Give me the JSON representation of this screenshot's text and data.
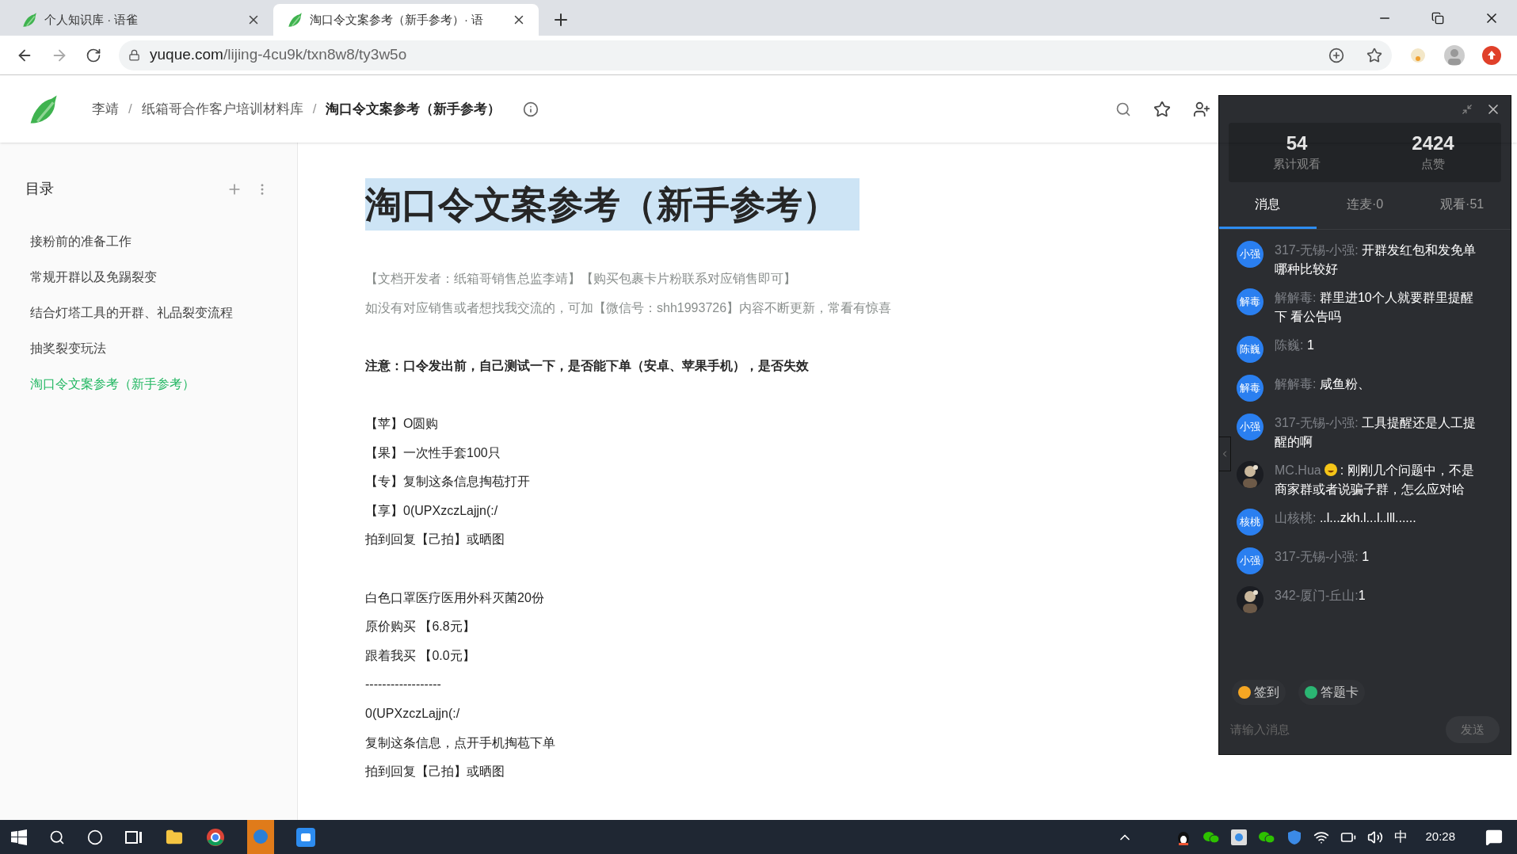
{
  "browser": {
    "tabs": [
      {
        "title": "个人知识库 · 语雀",
        "selected": false
      },
      {
        "title": "淘口令文案参考（新手参考）· 语",
        "selected": true
      }
    ],
    "url_host": "yuque.com",
    "url_path": "/lijing-4cu9k/txn8w8/ty3w5o"
  },
  "breadcrumb": [
    "李靖",
    "纸箱哥合作客户培训材料库",
    "淘口令文案参考（新手参考）"
  ],
  "breadcrumb_separator": "/",
  "sidebar": {
    "title": "目录",
    "items": [
      {
        "label": "接粉前的准备工作",
        "selected": false
      },
      {
        "label": "常规开群以及免踢裂变",
        "selected": false
      },
      {
        "label": "结合灯塔工具的开群、礼品裂变流程",
        "selected": false
      },
      {
        "label": "抽奖裂变玩法",
        "selected": false
      },
      {
        "label": "淘口令文案参考（新手参考）",
        "selected": true
      }
    ]
  },
  "document": {
    "title": "淘口令文案参考（新手参考）",
    "title_selected": true,
    "lines": [
      {
        "kind": "muted",
        "text": "【文档开发者：纸箱哥销售总监李靖】【购买包裹卡片粉联系对应销售即可】"
      },
      {
        "kind": "muted",
        "text": "如没有对应销售或者想找我交流的，可加【微信号：shh1993726】内容不断更新，常看有惊喜"
      },
      {
        "kind": "gap"
      },
      {
        "kind": "bold",
        "text": "注意：口令发出前，自己测试一下，是否能下单（安卓、苹果手机），是否失效"
      },
      {
        "kind": "gap"
      },
      {
        "kind": "text",
        "text": "【苹】O圆购"
      },
      {
        "kind": "text",
        "text": "【果】一次性手套100只"
      },
      {
        "kind": "text",
        "text": "【专】复制这条信息掏苞打开"
      },
      {
        "kind": "text",
        "text": "【享】0(UPXzczLajjn(:/"
      },
      {
        "kind": "text",
        "text": "拍到回复【己拍】或晒图"
      },
      {
        "kind": "gap"
      },
      {
        "kind": "text",
        "text": "白色口罩医疗医用外科灭菌20份"
      },
      {
        "kind": "text",
        "text": "原价购买 【6.8元】"
      },
      {
        "kind": "text",
        "text": "跟着我买 【0.0元】"
      },
      {
        "kind": "text",
        "text": "------------------"
      },
      {
        "kind": "text",
        "text": "0(UPXzczLajjn(:/"
      },
      {
        "kind": "text",
        "text": "复制这条信息，点开手机掏苞下单"
      },
      {
        "kind": "text",
        "text": "拍到回复【己拍】或晒图"
      }
    ]
  },
  "live_panel": {
    "stats": [
      {
        "value": "54",
        "label": "累计观看"
      },
      {
        "value": "2424",
        "label": "点赞"
      }
    ],
    "tabs": [
      {
        "label": "消息",
        "selected": true
      },
      {
        "label": "连麦·0",
        "selected": false
      },
      {
        "label": "观看·51",
        "selected": false
      }
    ],
    "messages": [
      {
        "kind": "text",
        "avatar": "小强",
        "name": "317-无锡-小强:",
        "text": "开群发红包和发免单哪种比较好"
      },
      {
        "kind": "text",
        "avatar": "解毒",
        "name": "解解毒:",
        "text": "群里进10个人就要群里提醒下 看公告吗"
      },
      {
        "kind": "text",
        "avatar": "陈巍",
        "name": "陈巍:",
        "text": "1"
      },
      {
        "kind": "text",
        "avatar": "解毒",
        "name": "解解毒:",
        "text": "咸鱼粉、"
      },
      {
        "kind": "text",
        "avatar": "小强",
        "name": "317-无锡-小强:",
        "text": "工具提醒还是人工提醒的啊"
      },
      {
        "kind": "picture",
        "name": "MC.Hua",
        "emoji": true,
        "text": ": 刚刚几个问题中，不是商家群或者说骗子群，怎么应对哈"
      },
      {
        "kind": "text",
        "avatar": "核桃",
        "name": "山核桃:",
        "text": "..l...zkh.l...l..lll......"
      },
      {
        "kind": "text",
        "avatar": "小强",
        "name": "317-无锡-小强:",
        "text": "1"
      },
      {
        "kind": "picture",
        "name": "342-厦门-丘山:",
        "text": "1"
      }
    ],
    "actions": [
      {
        "label": "签到",
        "color": "#f5a623"
      },
      {
        "label": "答题卡",
        "color": "#2bb673"
      }
    ],
    "input_placeholder": "请输入消息",
    "send": "发送"
  },
  "taskbar": {
    "ime": "中",
    "time": "20:28"
  }
}
